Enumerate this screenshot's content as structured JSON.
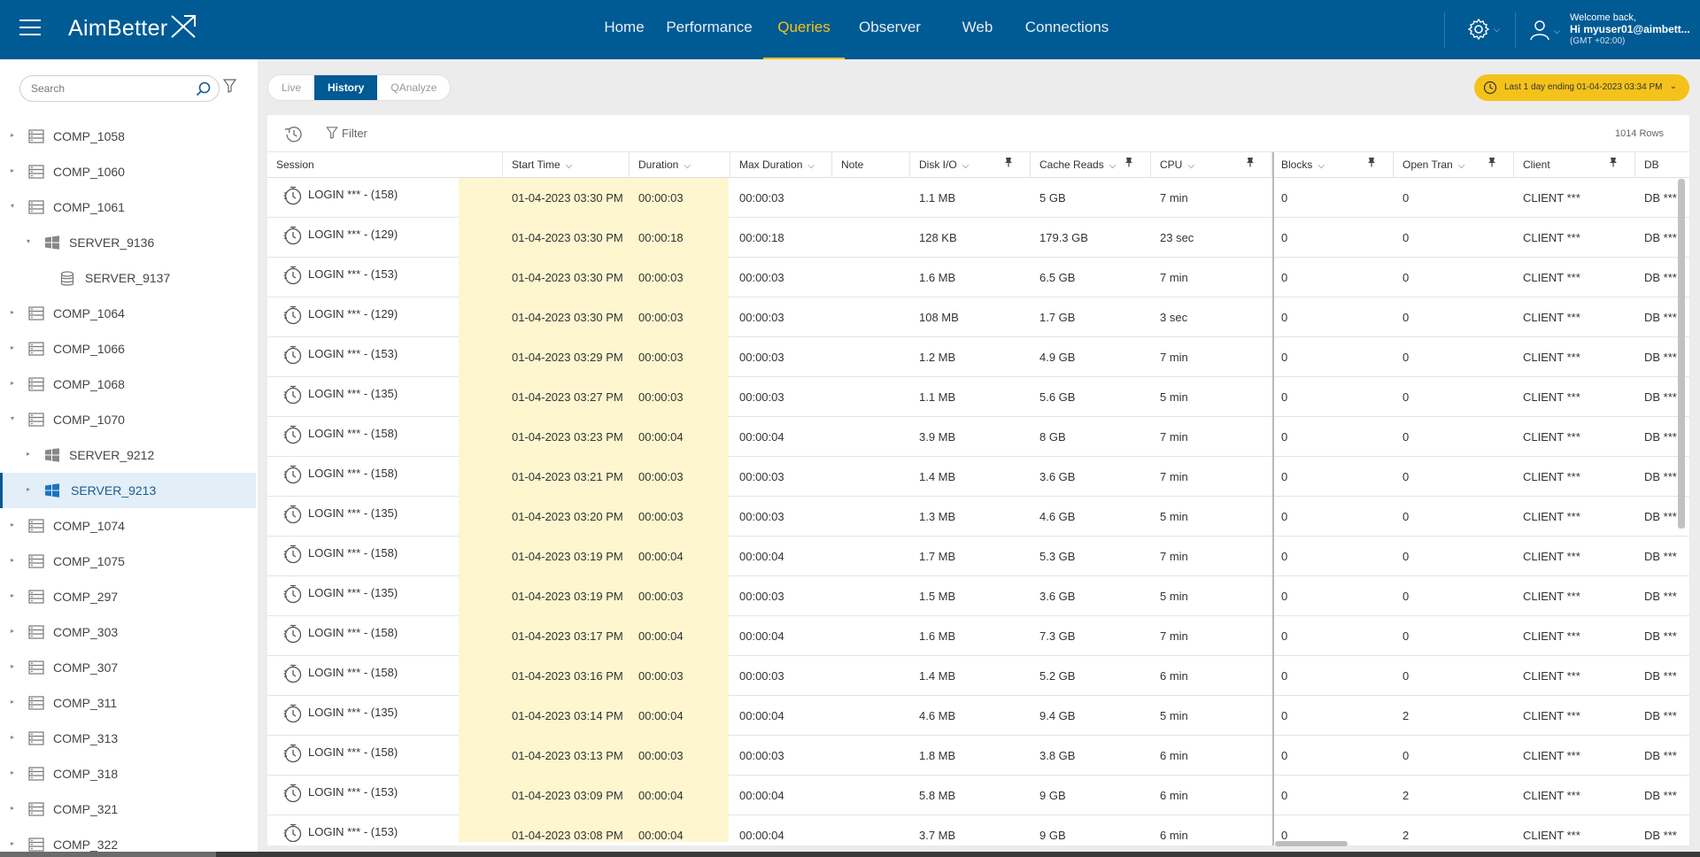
{
  "header": {
    "logo": "AimBetter",
    "nav": [
      {
        "label": "Home",
        "active": false
      },
      {
        "label": "Performance",
        "active": false
      },
      {
        "label": "Queries",
        "active": true
      },
      {
        "label": "Observer",
        "active": false
      },
      {
        "label": "Web",
        "active": false
      },
      {
        "label": "Connections",
        "active": false
      }
    ],
    "welcome": "Welcome back,",
    "user": "Hi myuser01@aimbett...",
    "timezone": "(GMT +02:00)"
  },
  "sidebar": {
    "search_placeholder": "Search",
    "items": [
      {
        "label": "COMP_1058",
        "level": 0,
        "icon": "server-rack-icon",
        "expanded": false
      },
      {
        "label": "COMP_1060",
        "level": 0,
        "icon": "server-rack-icon",
        "expanded": false
      },
      {
        "label": "COMP_1061",
        "level": 0,
        "icon": "server-rack-icon",
        "expanded": true
      },
      {
        "label": "SERVER_9136",
        "level": 1,
        "icon": "windows-icon",
        "expanded": true
      },
      {
        "label": "SERVER_9137",
        "level": 2,
        "icon": "database-icon",
        "expanded": null
      },
      {
        "label": "COMP_1064",
        "level": 0,
        "icon": "server-rack-icon",
        "expanded": false
      },
      {
        "label": "COMP_1066",
        "level": 0,
        "icon": "server-rack-icon",
        "expanded": false
      },
      {
        "label": "COMP_1068",
        "level": 0,
        "icon": "server-rack-icon",
        "expanded": false
      },
      {
        "label": "COMP_1070",
        "level": 0,
        "icon": "server-rack-icon",
        "expanded": true
      },
      {
        "label": "SERVER_9212",
        "level": 1,
        "icon": "windows-icon",
        "expanded": false
      },
      {
        "label": "SERVER_9213",
        "level": 1,
        "icon": "windows-icon",
        "expanded": false,
        "selected": true
      },
      {
        "label": "COMP_1074",
        "level": 0,
        "icon": "server-rack-icon",
        "expanded": false
      },
      {
        "label": "COMP_1075",
        "level": 0,
        "icon": "server-rack-icon",
        "expanded": false
      },
      {
        "label": "COMP_297",
        "level": 0,
        "icon": "server-rack-icon",
        "expanded": false
      },
      {
        "label": "COMP_303",
        "level": 0,
        "icon": "server-rack-icon",
        "expanded": false
      },
      {
        "label": "COMP_307",
        "level": 0,
        "icon": "server-rack-icon",
        "expanded": false
      },
      {
        "label": "COMP_311",
        "level": 0,
        "icon": "server-rack-icon",
        "expanded": false
      },
      {
        "label": "COMP_313",
        "level": 0,
        "icon": "server-rack-icon",
        "expanded": false
      },
      {
        "label": "COMP_318",
        "level": 0,
        "icon": "server-rack-icon",
        "expanded": false
      },
      {
        "label": "COMP_321",
        "level": 0,
        "icon": "server-rack-icon",
        "expanded": false
      },
      {
        "label": "COMP_322",
        "level": 0,
        "icon": "server-rack-icon",
        "expanded": false
      }
    ]
  },
  "tabs": [
    {
      "label": "Live",
      "active": false
    },
    {
      "label": "History",
      "active": true
    },
    {
      "label": "QAnalyze",
      "active": false
    }
  ],
  "timerange": "Last 1 day ending  01-04-2023 03:34 PM",
  "toolbar": {
    "filter_label": "Filter",
    "rows_count": "1014 Rows"
  },
  "columns": [
    {
      "label": "Session",
      "sort": false,
      "pin": false
    },
    {
      "label": "Start Time",
      "sort": true,
      "pin": false
    },
    {
      "label": "Duration",
      "sort": true,
      "pin": false
    },
    {
      "label": "Max Duration",
      "sort": true,
      "pin": false
    },
    {
      "label": "Note",
      "sort": false,
      "pin": false
    },
    {
      "label": "Disk I/O",
      "sort": true,
      "pin": true
    },
    {
      "label": "Cache Reads",
      "sort": true,
      "pin": true
    },
    {
      "label": "CPU",
      "sort": true,
      "pin": true
    },
    {
      "label": "Blocks",
      "sort": true,
      "pin": true
    },
    {
      "label": "Open Tran",
      "sort": true,
      "pin": true
    },
    {
      "label": "Client",
      "sort": false,
      "pin": true
    },
    {
      "label": "DB",
      "sort": false,
      "pin": false
    }
  ],
  "rows": [
    {
      "session": "LOGIN *** - (158)",
      "start": "01-04-2023 03:30 PM",
      "duration": "00:00:03",
      "max": "00:00:03",
      "note": "",
      "disk": "1.1 MB",
      "cache": "5 GB",
      "cpu": "7 min",
      "blocks": "0",
      "open": "0",
      "client": "CLIENT ***",
      "db": "DB ***"
    },
    {
      "session": "LOGIN *** - (129)",
      "start": "01-04-2023 03:30 PM",
      "duration": "00:00:18",
      "max": "00:00:18",
      "note": "",
      "disk": "128 KB",
      "cache": "179.3 GB",
      "cpu": "23 sec",
      "blocks": "0",
      "open": "0",
      "client": "CLIENT ***",
      "db": "DB ***"
    },
    {
      "session": "LOGIN *** - (153)",
      "start": "01-04-2023 03:30 PM",
      "duration": "00:00:03",
      "max": "00:00:03",
      "note": "",
      "disk": "1.6 MB",
      "cache": "6.5 GB",
      "cpu": "7 min",
      "blocks": "0",
      "open": "0",
      "client": "CLIENT ***",
      "db": "DB ***"
    },
    {
      "session": "LOGIN *** - (129)",
      "start": "01-04-2023 03:30 PM",
      "duration": "00:00:03",
      "max": "00:00:03",
      "note": "",
      "disk": "108 MB",
      "cache": "1.7 GB",
      "cpu": "3 sec",
      "blocks": "0",
      "open": "0",
      "client": "CLIENT ***",
      "db": "DB ***"
    },
    {
      "session": "LOGIN *** - (153)",
      "start": "01-04-2023 03:29 PM",
      "duration": "00:00:03",
      "max": "00:00:03",
      "note": "",
      "disk": "1.2 MB",
      "cache": "4.9 GB",
      "cpu": "7 min",
      "blocks": "0",
      "open": "0",
      "client": "CLIENT ***",
      "db": "DB ***"
    },
    {
      "session": "LOGIN *** - (135)",
      "start": "01-04-2023 03:27 PM",
      "duration": "00:00:03",
      "max": "00:00:03",
      "note": "",
      "disk": "1.1 MB",
      "cache": "5.6 GB",
      "cpu": "5 min",
      "blocks": "0",
      "open": "0",
      "client": "CLIENT ***",
      "db": "DB ***"
    },
    {
      "session": "LOGIN *** - (158)",
      "start": "01-04-2023 03:23 PM",
      "duration": "00:00:04",
      "max": "00:00:04",
      "note": "",
      "disk": "3.9 MB",
      "cache": "8 GB",
      "cpu": "7 min",
      "blocks": "0",
      "open": "0",
      "client": "CLIENT ***",
      "db": "DB ***"
    },
    {
      "session": "LOGIN *** - (158)",
      "start": "01-04-2023 03:21 PM",
      "duration": "00:00:03",
      "max": "00:00:03",
      "note": "",
      "disk": "1.4 MB",
      "cache": "3.6 GB",
      "cpu": "7 min",
      "blocks": "0",
      "open": "0",
      "client": "CLIENT ***",
      "db": "DB ***"
    },
    {
      "session": "LOGIN *** - (135)",
      "start": "01-04-2023 03:20 PM",
      "duration": "00:00:03",
      "max": "00:00:03",
      "note": "",
      "disk": "1.3 MB",
      "cache": "4.6 GB",
      "cpu": "5 min",
      "blocks": "0",
      "open": "0",
      "client": "CLIENT ***",
      "db": "DB ***"
    },
    {
      "session": "LOGIN *** - (158)",
      "start": "01-04-2023 03:19 PM",
      "duration": "00:00:04",
      "max": "00:00:04",
      "note": "",
      "disk": "1.7 MB",
      "cache": "5.3 GB",
      "cpu": "7 min",
      "blocks": "0",
      "open": "0",
      "client": "CLIENT ***",
      "db": "DB ***"
    },
    {
      "session": "LOGIN *** - (135)",
      "start": "01-04-2023 03:19 PM",
      "duration": "00:00:03",
      "max": "00:00:03",
      "note": "",
      "disk": "1.5 MB",
      "cache": "3.6 GB",
      "cpu": "5 min",
      "blocks": "0",
      "open": "0",
      "client": "CLIENT ***",
      "db": "DB ***"
    },
    {
      "session": "LOGIN *** - (158)",
      "start": "01-04-2023 03:17 PM",
      "duration": "00:00:04",
      "max": "00:00:04",
      "note": "",
      "disk": "1.6 MB",
      "cache": "7.3 GB",
      "cpu": "7 min",
      "blocks": "0",
      "open": "0",
      "client": "CLIENT ***",
      "db": "DB ***"
    },
    {
      "session": "LOGIN *** - (158)",
      "start": "01-04-2023 03:16 PM",
      "duration": "00:00:03",
      "max": "00:00:03",
      "note": "",
      "disk": "1.4 MB",
      "cache": "5.2 GB",
      "cpu": "6 min",
      "blocks": "0",
      "open": "0",
      "client": "CLIENT ***",
      "db": "DB ***"
    },
    {
      "session": "LOGIN *** - (135)",
      "start": "01-04-2023 03:14 PM",
      "duration": "00:00:04",
      "max": "00:00:04",
      "note": "",
      "disk": "4.6 MB",
      "cache": "9.4 GB",
      "cpu": "5 min",
      "blocks": "0",
      "open": "2",
      "client": "CLIENT ***",
      "db": "DB ***"
    },
    {
      "session": "LOGIN *** - (158)",
      "start": "01-04-2023 03:13 PM",
      "duration": "00:00:03",
      "max": "00:00:03",
      "note": "",
      "disk": "1.8 MB",
      "cache": "3.8 GB",
      "cpu": "6 min",
      "blocks": "0",
      "open": "0",
      "client": "CLIENT ***",
      "db": "DB ***"
    },
    {
      "session": "LOGIN *** - (153)",
      "start": "01-04-2023 03:09 PM",
      "duration": "00:00:04",
      "max": "00:00:04",
      "note": "",
      "disk": "5.8 MB",
      "cache": "9 GB",
      "cpu": "6 min",
      "blocks": "0",
      "open": "2",
      "client": "CLIENT ***",
      "db": "DB ***"
    },
    {
      "session": "LOGIN *** - (153)",
      "start": "01-04-2023 03:08 PM",
      "duration": "00:00:04",
      "max": "00:00:04",
      "note": "",
      "disk": "3.7 MB",
      "cache": "9 GB",
      "cpu": "6 min",
      "blocks": "0",
      "open": "2",
      "client": "CLIENT ***",
      "db": "DB ***"
    }
  ],
  "colors": {
    "primary": "#005a94",
    "accent": "#f5c21a",
    "highlight": "#fdf6cf"
  }
}
